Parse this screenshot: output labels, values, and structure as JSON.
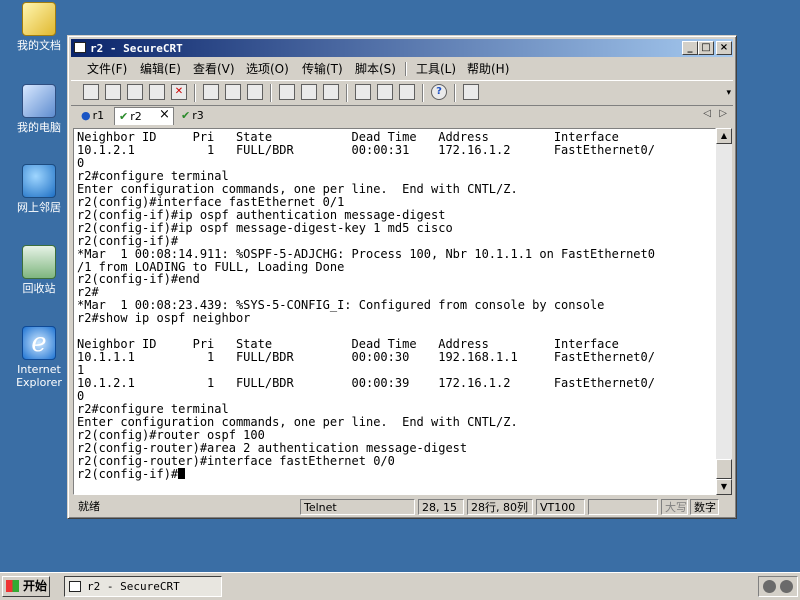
{
  "desktop": {
    "icons": [
      {
        "label": "我的文档",
        "icon": "my-documents-icon"
      },
      {
        "label": "我的电脑",
        "icon": "my-computer-icon"
      },
      {
        "label": "网上邻居",
        "icon": "network-places-icon"
      },
      {
        "label": "回收站",
        "icon": "recycle-bin-icon"
      },
      {
        "label": "Internet Explorer",
        "icon": "internet-explorer-icon",
        "glyph": "e"
      }
    ]
  },
  "window": {
    "title": "r2 - SecureCRT",
    "controls": {
      "minimize": "_",
      "maximize": "□",
      "close": "×"
    }
  },
  "menu": [
    "文件(F)",
    "编辑(E)",
    "查看(V)",
    "选项(O)",
    "传输(T)",
    "脚本(S)",
    "工具(L)",
    "帮助(H)"
  ],
  "tabs": [
    {
      "label": "r1",
      "marker": "●",
      "active": false
    },
    {
      "label": "r2",
      "marker": "✔",
      "active": true
    },
    {
      "label": "r3",
      "marker": "✔",
      "active": false
    }
  ],
  "tab_close": "×",
  "tab_arrows": {
    "left": "◁",
    "right": "▷"
  },
  "terminal": {
    "lines": [
      "Neighbor ID     Pri   State           Dead Time   Address         Interface",
      "10.1.2.1          1   FULL/BDR        00:00:31    172.16.1.2      FastEthernet0/",
      "0",
      "r2#configure terminal",
      "Enter configuration commands, one per line.  End with CNTL/Z.",
      "r2(config)#interface fastEthernet 0/1",
      "r2(config-if)#ip ospf authentication message-digest",
      "r2(config-if)#ip ospf message-digest-key 1 md5 cisco",
      "r2(config-if)#",
      "*Mar  1 00:08:14.911: %OSPF-5-ADJCHG: Process 100, Nbr 10.1.1.1 on FastEthernet0",
      "/1 from LOADING to FULL, Loading Done",
      "r2(config-if)#end",
      "r2#",
      "*Mar  1 00:08:23.439: %SYS-5-CONFIG_I: Configured from console by console",
      "r2#show ip ospf neighbor",
      "",
      "Neighbor ID     Pri   State           Dead Time   Address         Interface",
      "10.1.1.1          1   FULL/BDR        00:00:30    192.168.1.1     FastEthernet0/",
      "1",
      "10.1.2.1          1   FULL/BDR        00:00:39    172.16.1.2      FastEthernet0/",
      "0",
      "r2#configure terminal",
      "Enter configuration commands, one per line.  End with CNTL/Z.",
      "r2(config)#router ospf 100",
      "r2(config-router)#area 2 authentication message-digest",
      "r2(config-router)#interface fastEthernet 0/0"
    ],
    "prompt": "r2(config-if)#"
  },
  "scroll": {
    "up": "▲",
    "down": "▼"
  },
  "status": {
    "ready": "就绪",
    "protocol": "Telnet",
    "cursor_pos": "28, 15",
    "size": "28行, 80列",
    "emulation": "VT100",
    "caps": "大写",
    "num": "数字"
  },
  "taskbar": {
    "start": "开始",
    "task": "r2 - SecureCRT"
  }
}
